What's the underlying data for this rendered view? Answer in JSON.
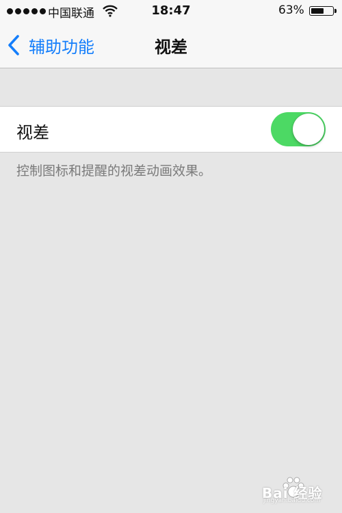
{
  "status_bar": {
    "carrier": "中国联通",
    "time": "18:47",
    "battery_percent": "63%",
    "battery_level": 0.63
  },
  "nav": {
    "back_label": "辅助功能",
    "title": "视差"
  },
  "setting": {
    "label": "视差",
    "toggle_on": true,
    "toggle_color": "#4cd964",
    "footer": "控制图标和提醒的视差动画效果。"
  },
  "watermark": {
    "text": "Bai 经验",
    "url": "jingyan.baidu.com"
  },
  "colors": {
    "accent": "#147efb",
    "background": "#e6e6e6"
  }
}
